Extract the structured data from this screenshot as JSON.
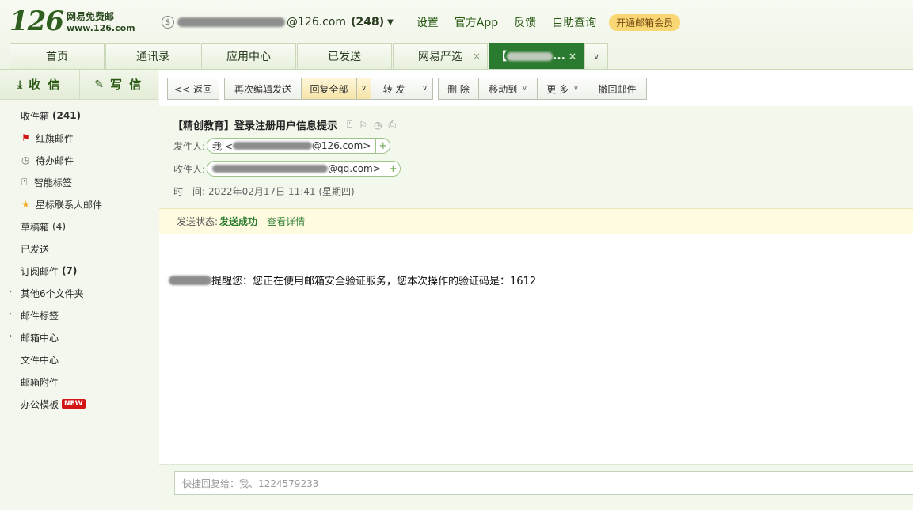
{
  "brand": {
    "logo_number": "126",
    "logo_cn": "网易免费邮",
    "logo_url": "www.126.com"
  },
  "account": {
    "email_suffix": "@126.com",
    "unread_count": "(248)",
    "coin_icon": "coin-icon"
  },
  "top_links": [
    "设置",
    "官方App",
    "反馈",
    "自助查询"
  ],
  "vip_button": "开通邮箱会员",
  "tabs": [
    {
      "label": "首页"
    },
    {
      "label": "通讯录"
    },
    {
      "label": "应用中心"
    },
    {
      "label": "已发送"
    },
    {
      "label": "网易严选",
      "close": "×"
    },
    {
      "label": "【",
      "suffix": "...",
      "close": "×"
    }
  ],
  "sidebar": {
    "receive_label": "收 信",
    "compose_label": "写 信",
    "folders": [
      {
        "label": "收件箱",
        "count": "(241)"
      },
      {
        "label": "红旗邮件"
      },
      {
        "label": "待办邮件"
      },
      {
        "label": "智能标签"
      },
      {
        "label": "星标联系人邮件"
      },
      {
        "label": "草稿箱",
        "count": "(4)"
      },
      {
        "label": "已发送"
      },
      {
        "label": "订阅邮件",
        "count": "(7)"
      },
      {
        "label": "其他6个文件夹"
      },
      {
        "label": "邮件标签"
      },
      {
        "label": "邮箱中心"
      },
      {
        "label": "文件中心"
      },
      {
        "label": "邮箱附件"
      },
      {
        "label": "办公模板",
        "badge": "NEW"
      }
    ]
  },
  "toolbar": {
    "back": "<< 返回",
    "re_edit": "再次编辑发送",
    "reply_all": "回复全部",
    "forward": "转 发",
    "delete": "删 除",
    "move_to": "移动到",
    "more": "更 多",
    "recall": "撤回邮件"
  },
  "mail": {
    "subject": "【精创教育】登录注册用户信息提示",
    "from_label": "发件人:",
    "from_prefix": "我 <",
    "from_suffix": "@126.com>",
    "to_label": "收件人:",
    "to_suffix": "@qq.com>",
    "time_label": "时　间:",
    "time_value": "2022年02月17日 11:41 (星期四)",
    "status_label": "发送状态:",
    "status_value": "发送成功",
    "status_link": "查看详情",
    "body": "提醒您：您正在使用邮箱安全验证服务，您本次操作的验证码是：1612"
  },
  "quick_reply": {
    "placeholder": "快捷回复给：我、1224579233"
  }
}
